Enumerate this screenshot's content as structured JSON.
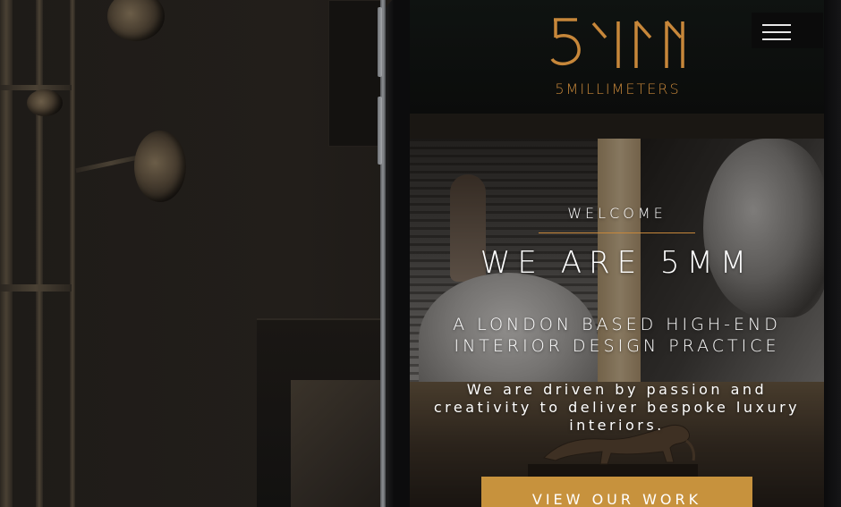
{
  "header": {
    "logo_wordmark": "5MILLIMETERS",
    "logo_icon": "5mm-monogram-icon",
    "menu_icon": "hamburger-menu-icon"
  },
  "hero": {
    "welcome": "WELCOME",
    "headline": "WE ARE 5MM",
    "subhead_line1": "A LONDON BASED HIGH-END",
    "subhead_line2": "INTERIOR DESIGN PRACTICE",
    "tagline": "We are driven by passion and creativity to deliver bespoke luxury interiors.",
    "cta_label": "VIEW OUR WORK"
  },
  "colors": {
    "accent": "#c7873a",
    "button": "#c7923d",
    "header_bg": "#0d0e0d",
    "text": "#ffffff"
  }
}
